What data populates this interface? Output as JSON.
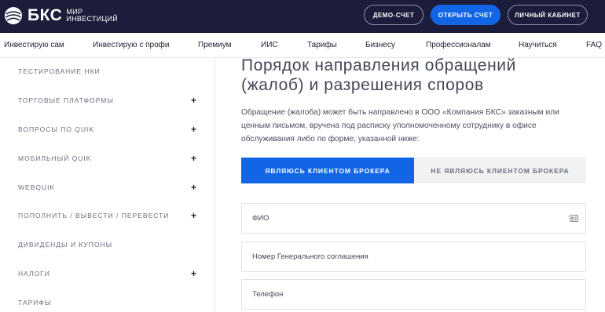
{
  "header": {
    "logo_text": "БКС",
    "logo_sub_1": "МИР",
    "logo_sub_2": "ИНВЕСТИЦИЙ",
    "demo_label": "ДЕМО-СЧЕТ",
    "open_label": "ОТКРЫТЬ СЧЕТ",
    "cabinet_label": "ЛИЧНЫЙ КАБИНЕТ"
  },
  "nav": {
    "items": [
      "Инвестирую сам",
      "Инвестирую с профи",
      "Премиум",
      "ИИС",
      "Тарифы",
      "Бизнесу",
      "Профессионалам",
      "Научиться",
      "FAQ"
    ]
  },
  "sidebar": {
    "items": [
      {
        "label": "ТЕСТИРОВАНИЕ НКИ",
        "expandable": false
      },
      {
        "label": "ТОРГОВЫЕ ПЛАТФОРМЫ",
        "expandable": true
      },
      {
        "label": "ВОПРОСЫ ПО QUIK",
        "expandable": true
      },
      {
        "label": "МОБИЛЬНЫЙ QUIK",
        "expandable": true
      },
      {
        "label": "WEBQUIK",
        "expandable": true
      },
      {
        "label": "ПОПОЛНИТЬ / ВЫВЕСТИ / ПЕРЕВЕСТИ",
        "expandable": true
      },
      {
        "label": "ДИВИДЕНДЫ И КУПОНЫ",
        "expandable": false
      },
      {
        "label": "НАЛОГИ",
        "expandable": true
      },
      {
        "label": "ТАРИФЫ",
        "expandable": false
      }
    ],
    "plus": "+"
  },
  "main": {
    "title_line1": "Порядок направления обращений",
    "title_line2": "(жалоб) и разрешения споров",
    "intro": "Обращение (жалоба) может быть направлено в ООО «Компания БКС» заказным или ценным письмом, вручена под расписку уполномоченному сотруднику в офисе обслуживания либо по форме, указанной ниже:",
    "toggle_client": "ЯВЛЯЮСЬ КЛИЕНТОМ БРОКЕРА",
    "toggle_non_client": "НЕ ЯВЛЯЮСЬ КЛИЕНТОМ БРОКЕРА",
    "fields": {
      "fio_placeholder": "ФИО",
      "contract_placeholder": "Номер Генерального соглашения",
      "phone_placeholder": "Телефон"
    }
  },
  "colors": {
    "header_bg": "#1b1d3a",
    "accent": "#1266e6",
    "inactive_tab_bg": "#f1f2f4"
  },
  "icons": {
    "logo": "globe-logo-icon",
    "field_card": "id-card-icon"
  }
}
